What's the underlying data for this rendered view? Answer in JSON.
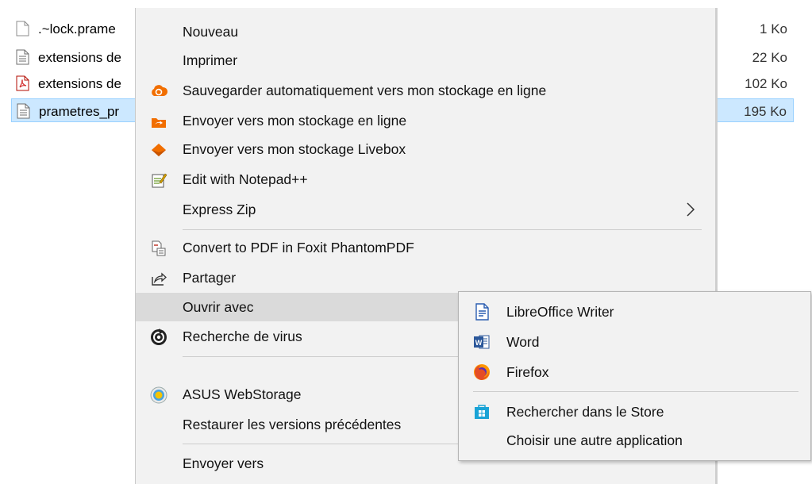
{
  "files": [
    {
      "name": ".~lock.prame",
      "size": "1 Ko",
      "icon": "blank-file-icon"
    },
    {
      "name": "extensions de",
      "size": "22 Ko",
      "icon": "text-file-icon"
    },
    {
      "name": "extensions de",
      "size": "102 Ko",
      "icon": "pdf-file-icon"
    },
    {
      "name": "prametres_pr",
      "size": "195 Ko",
      "icon": "text-file-icon",
      "selected": true
    }
  ],
  "menu": {
    "items": [
      {
        "label": "Nouveau"
      },
      {
        "label": "Imprimer"
      },
      {
        "label": "Sauvegarder automatiquement vers mon stockage en ligne",
        "icon": "cloud-sync-icon"
      },
      {
        "label": "Envoyer vers mon stockage en ligne",
        "icon": "cloud-folder-icon"
      },
      {
        "label": "Envoyer vers mon stockage Livebox",
        "icon": "livebox-icon"
      },
      {
        "label": "Edit with Notepad++",
        "icon": "notepad-plus-icon"
      },
      {
        "label": "Express Zip",
        "has_submenu": true
      },
      {
        "label": "Convert to PDF in Foxit PhantomPDF",
        "icon": "foxit-pdf-icon"
      },
      {
        "label": "Partager",
        "icon": "share-icon"
      },
      {
        "label": "Ouvrir avec",
        "highlighted": true
      },
      {
        "label": "Recherche de virus",
        "icon": "antivirus-icon"
      },
      {
        "label": "ASUS WebStorage",
        "icon": "asus-webstorage-icon"
      },
      {
        "label": "Restaurer les versions précédentes"
      },
      {
        "label": "Envoyer vers"
      }
    ]
  },
  "submenu": {
    "items": [
      {
        "label": "LibreOffice Writer",
        "icon": "libreoffice-writer-icon"
      },
      {
        "label": "Word",
        "icon": "word-icon"
      },
      {
        "label": "Firefox",
        "icon": "firefox-icon"
      },
      {
        "label": "Rechercher dans le Store",
        "icon": "store-icon"
      },
      {
        "label": "Choisir une autre application"
      }
    ]
  },
  "colors": {
    "menu_bg": "#f2f2f2",
    "menu_hover": "#dadada",
    "selection": "#cce8ff",
    "orange": "#f16e00",
    "word_blue": "#2b579a"
  }
}
